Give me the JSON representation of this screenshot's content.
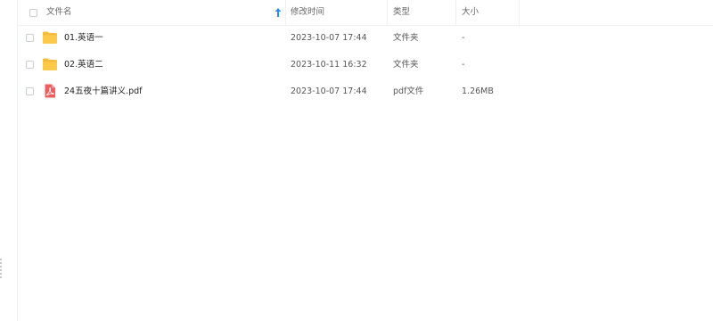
{
  "columns": {
    "name": "文件名",
    "modified": "修改时间",
    "type": "类型",
    "size": "大小"
  },
  "colors": {
    "folder": "#f6bd3c",
    "pdf": "#ee5e5e",
    "sort_arrow": "#2d8cf0"
  },
  "files": [
    {
      "name": "01.英语一",
      "modified": "2023-10-07 17:44",
      "type": "文件夹",
      "size": "-",
      "icon": "folder-icon"
    },
    {
      "name": "02.英语二",
      "modified": "2023-10-11 16:32",
      "type": "文件夹",
      "size": "-",
      "icon": "folder-icon"
    },
    {
      "name": "24五夜十篇讲义.pdf",
      "modified": "2023-10-07 17:44",
      "type": "pdf文件",
      "size": "1.26MB",
      "icon": "pdf-icon"
    }
  ]
}
